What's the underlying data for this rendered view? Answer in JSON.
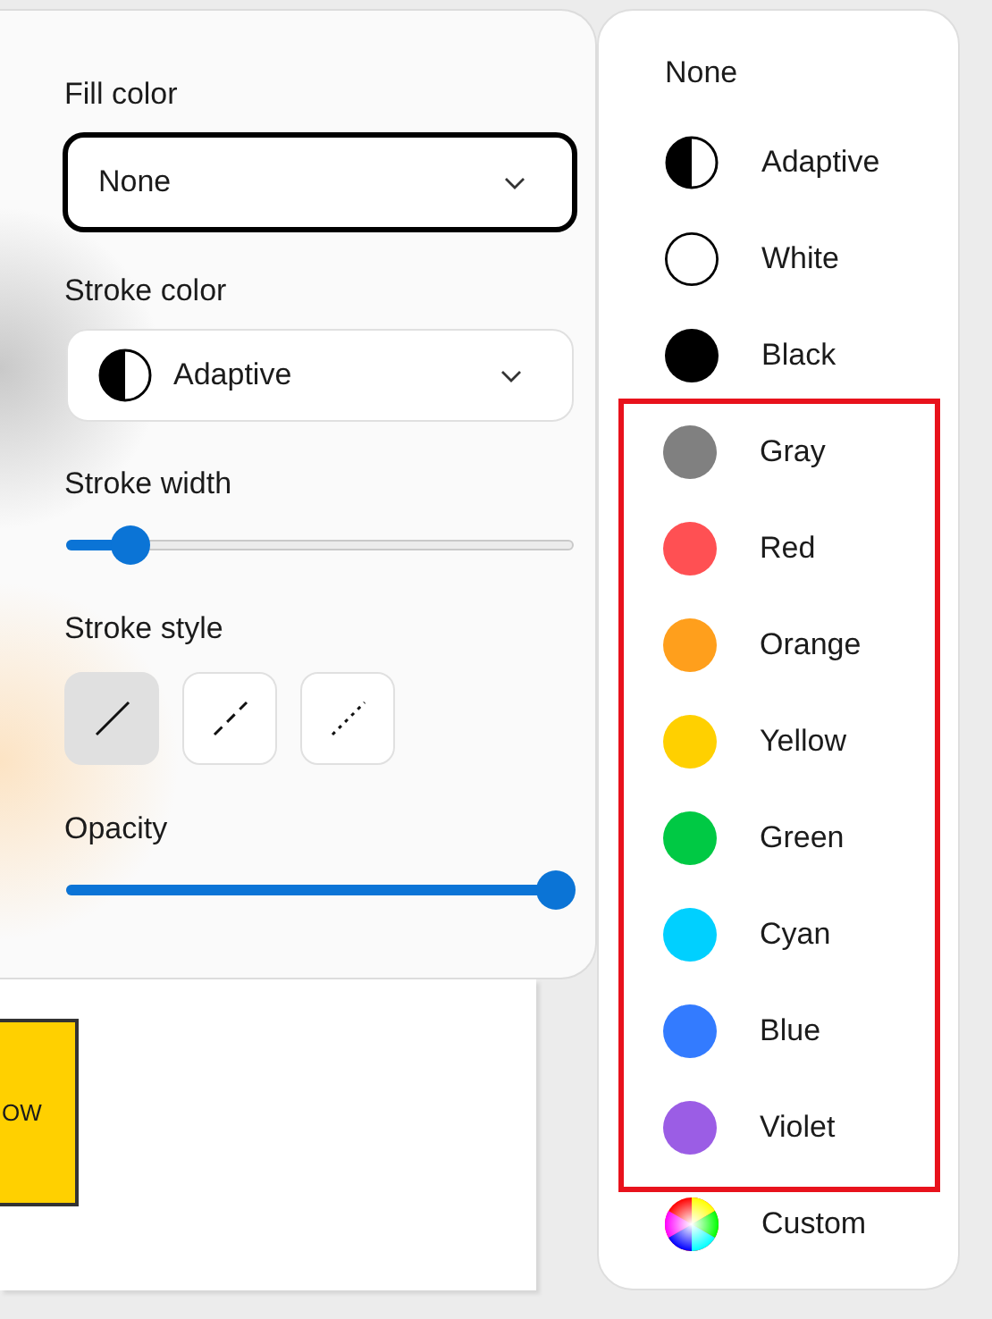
{
  "properties": {
    "fill_color": {
      "label": "Fill color",
      "value": "None",
      "focused": true
    },
    "stroke_color": {
      "label": "Stroke color",
      "value": "Adaptive",
      "focused": false
    },
    "stroke_width": {
      "label": "Stroke width",
      "level": 0.1
    },
    "stroke_style": {
      "label": "Stroke style",
      "options": [
        {
          "kind": "solid",
          "selected": true
        },
        {
          "kind": "dashed",
          "selected": false
        },
        {
          "kind": "dotted",
          "selected": false
        }
      ]
    },
    "opacity": {
      "label": "Opacity",
      "level": 1
    }
  },
  "canvas": {
    "shape_text": "OW"
  },
  "color_menu": {
    "items": [
      {
        "label": "None",
        "kind": "none",
        "highlighted": false
      },
      {
        "label": "Adaptive",
        "kind": "adaptive",
        "highlighted": false
      },
      {
        "label": "White",
        "kind": "swatch",
        "color": "#ffffff",
        "highlighted": false
      },
      {
        "label": "Black",
        "kind": "swatch",
        "color": "#000000",
        "highlighted": false
      },
      {
        "label": "Gray",
        "kind": "swatch",
        "color": "#808080",
        "highlighted": true
      },
      {
        "label": "Red",
        "kind": "swatch",
        "color": "#ff5053",
        "highlighted": true
      },
      {
        "label": "Orange",
        "kind": "swatch",
        "color": "#ff9f1c",
        "highlighted": true
      },
      {
        "label": "Yellow",
        "kind": "swatch",
        "color": "#ffd000",
        "highlighted": true
      },
      {
        "label": "Green",
        "kind": "swatch",
        "color": "#00c944",
        "highlighted": true
      },
      {
        "label": "Cyan",
        "kind": "swatch",
        "color": "#00d0ff",
        "highlighted": true
      },
      {
        "label": "Blue",
        "kind": "swatch",
        "color": "#337bff",
        "highlighted": true
      },
      {
        "label": "Violet",
        "kind": "swatch",
        "color": "#9b5de5",
        "highlighted": true
      },
      {
        "label": "Custom",
        "kind": "custom",
        "highlighted": false
      }
    ]
  }
}
